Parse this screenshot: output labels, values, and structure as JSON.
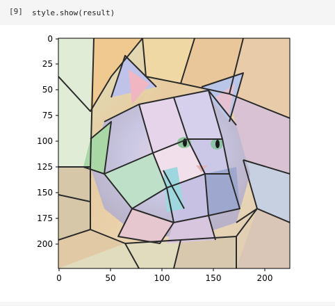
{
  "cell": {
    "prompt": "[9]",
    "code": "style.show(result)"
  },
  "output": {
    "image_description_icon": "stylized-stained-glass-cat-image",
    "x_ticks": [
      "0",
      "50",
      "100",
      "150",
      "200"
    ],
    "y_ticks": [
      "0",
      "25",
      "50",
      "75",
      "100",
      "125",
      "150",
      "175",
      "200"
    ],
    "colors": {
      "cell_background": "#f5f5f5",
      "axis": "#000000"
    }
  }
}
